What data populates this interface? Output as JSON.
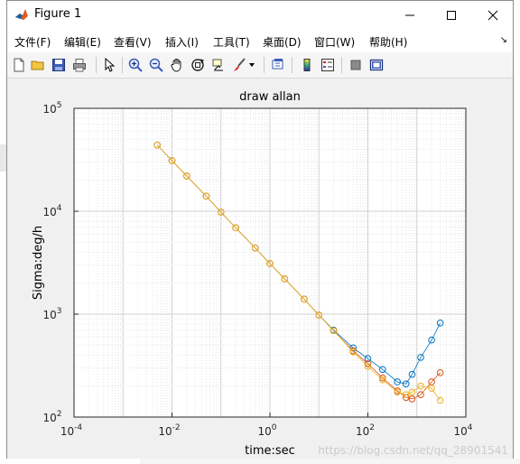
{
  "window": {
    "title": "Figure 1"
  },
  "menu": [
    {
      "label": "文件(F)"
    },
    {
      "label": "编辑(E)"
    },
    {
      "label": "查看(V)"
    },
    {
      "label": "插入(I)"
    },
    {
      "label": "工具(T)"
    },
    {
      "label": "桌面(D)"
    },
    {
      "label": "窗口(W)"
    },
    {
      "label": "帮助(H)"
    }
  ],
  "toolbar": {
    "icons": [
      "new-figure-icon",
      "open-file-icon",
      "save-icon",
      "print-icon",
      "pointer-icon",
      "zoom-in-icon",
      "zoom-out-icon",
      "pan-hand-icon",
      "rotate-3d-icon",
      "data-cursor-icon",
      "brush-icon",
      "brush-dropdown-icon",
      "link-plot-icon",
      "colorbar-icon",
      "legend-icon",
      "hide-plot-tools-icon",
      "show-plot-tools-icon"
    ]
  },
  "watermark": "https://blog.csdn.net/qq_28901541",
  "chart_data": {
    "type": "scatter",
    "title": "draw allan",
    "xlabel": "time:sec",
    "ylabel": "Sigma:deg/h",
    "xscale": "log",
    "yscale": "log",
    "xlim": [
      0.0001,
      10000
    ],
    "ylim": [
      100,
      100000
    ],
    "xticks": [
      {
        "base": "10",
        "exp": "-4"
      },
      {
        "base": "10",
        "exp": "-2"
      },
      {
        "base": "10",
        "exp": "0"
      },
      {
        "base": "10",
        "exp": "2"
      },
      {
        "base": "10",
        "exp": "4"
      }
    ],
    "yticks": [
      {
        "base": "10",
        "exp": "2"
      },
      {
        "base": "10",
        "exp": "3"
      },
      {
        "base": "10",
        "exp": "4"
      },
      {
        "base": "10",
        "exp": "5"
      }
    ],
    "grid": true,
    "minor_grid": true,
    "marker": "circle",
    "series": [
      {
        "color": "#0072bd",
        "x": [
          0.005,
          0.01,
          0.02,
          0.05,
          0.1,
          0.2,
          0.5,
          1,
          2,
          5,
          10,
          20,
          50,
          100,
          200,
          400,
          600,
          800,
          1200,
          2000,
          3000
        ],
        "y": [
          44000,
          31000,
          22000,
          14000,
          9800,
          6900,
          4400,
          3100,
          2200,
          1400,
          980,
          700,
          470,
          370,
          290,
          220,
          210,
          260,
          380,
          560,
          820
        ]
      },
      {
        "color": "#d95319",
        "x": [
          0.005,
          0.01,
          0.02,
          0.05,
          0.1,
          0.2,
          0.5,
          1,
          2,
          5,
          10,
          20,
          50,
          100,
          200,
          400,
          600,
          800,
          1200,
          2000,
          3000
        ],
        "y": [
          44000,
          31000,
          22000,
          14000,
          9800,
          6900,
          4400,
          3100,
          2200,
          1400,
          980,
          690,
          440,
          330,
          240,
          180,
          155,
          150,
          165,
          220,
          270
        ]
      },
      {
        "color": "#edb120",
        "x": [
          0.005,
          0.01,
          0.02,
          0.05,
          0.1,
          0.2,
          0.5,
          1,
          2,
          5,
          10,
          20,
          50,
          100,
          200,
          400,
          600,
          800,
          1200,
          2000,
          3000
        ],
        "y": [
          44000,
          31000,
          22000,
          14000,
          9800,
          6900,
          4400,
          3100,
          2200,
          1400,
          980,
          690,
          430,
          310,
          230,
          175,
          165,
          175,
          200,
          190,
          145
        ]
      }
    ]
  }
}
